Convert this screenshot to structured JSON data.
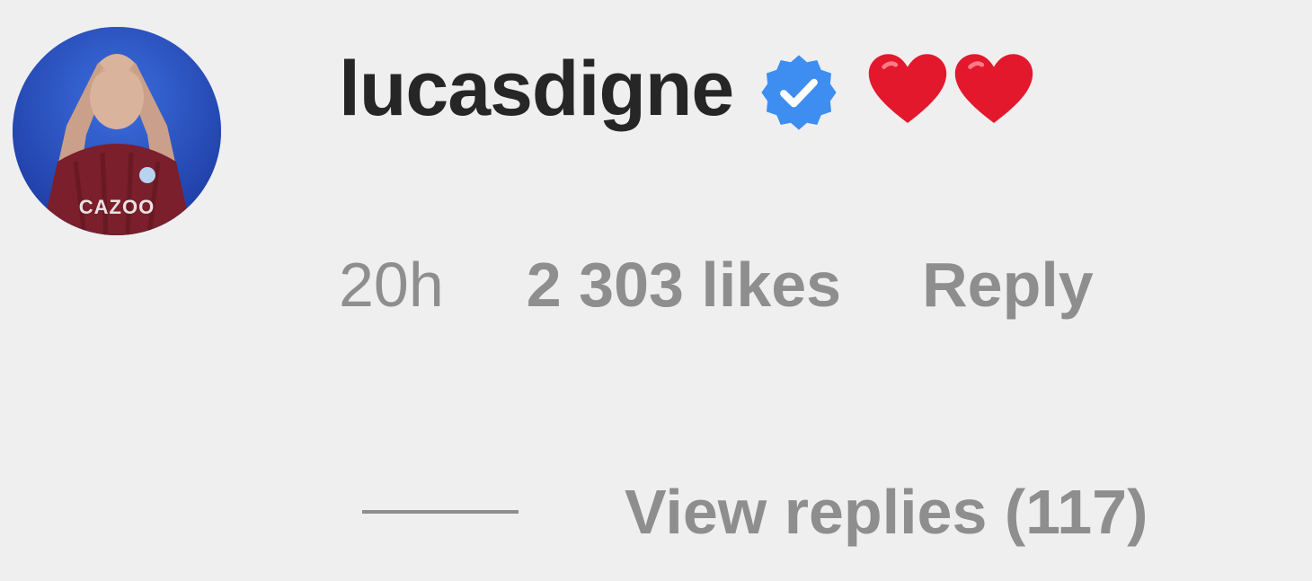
{
  "comment": {
    "username": "lucasdigne",
    "verified_icon": "verified-badge-icon",
    "text": "❤️❤️",
    "colors": {
      "username": "#262626",
      "meta": "#8e8e8e",
      "verified": "#3d8ef0",
      "heart": "#e3182d",
      "background": "#efefef"
    },
    "meta": {
      "time": "20h",
      "likes": "2 303 likes",
      "reply_label": "Reply"
    },
    "view_replies_label": "View replies (117)"
  }
}
